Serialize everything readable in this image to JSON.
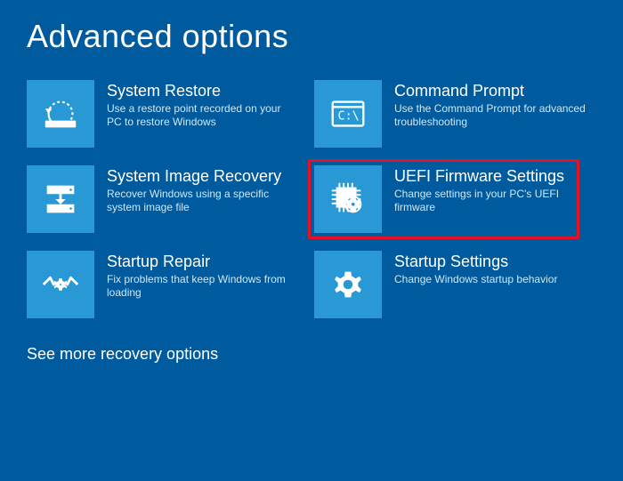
{
  "title": "Advanced options",
  "options": [
    {
      "title": "System Restore",
      "desc": "Use a restore point recorded on your PC to restore Windows"
    },
    {
      "title": "Command Prompt",
      "desc": "Use the Command Prompt for advanced troubleshooting"
    },
    {
      "title": "System Image Recovery",
      "desc": "Recover Windows using a specific system image file"
    },
    {
      "title": "UEFI Firmware Settings",
      "desc": "Change settings in your PC's UEFI firmware"
    },
    {
      "title": "Startup Repair",
      "desc": "Fix problems that keep Windows from loading"
    },
    {
      "title": "Startup Settings",
      "desc": "Change Windows startup behavior"
    }
  ],
  "more": "See more recovery options"
}
